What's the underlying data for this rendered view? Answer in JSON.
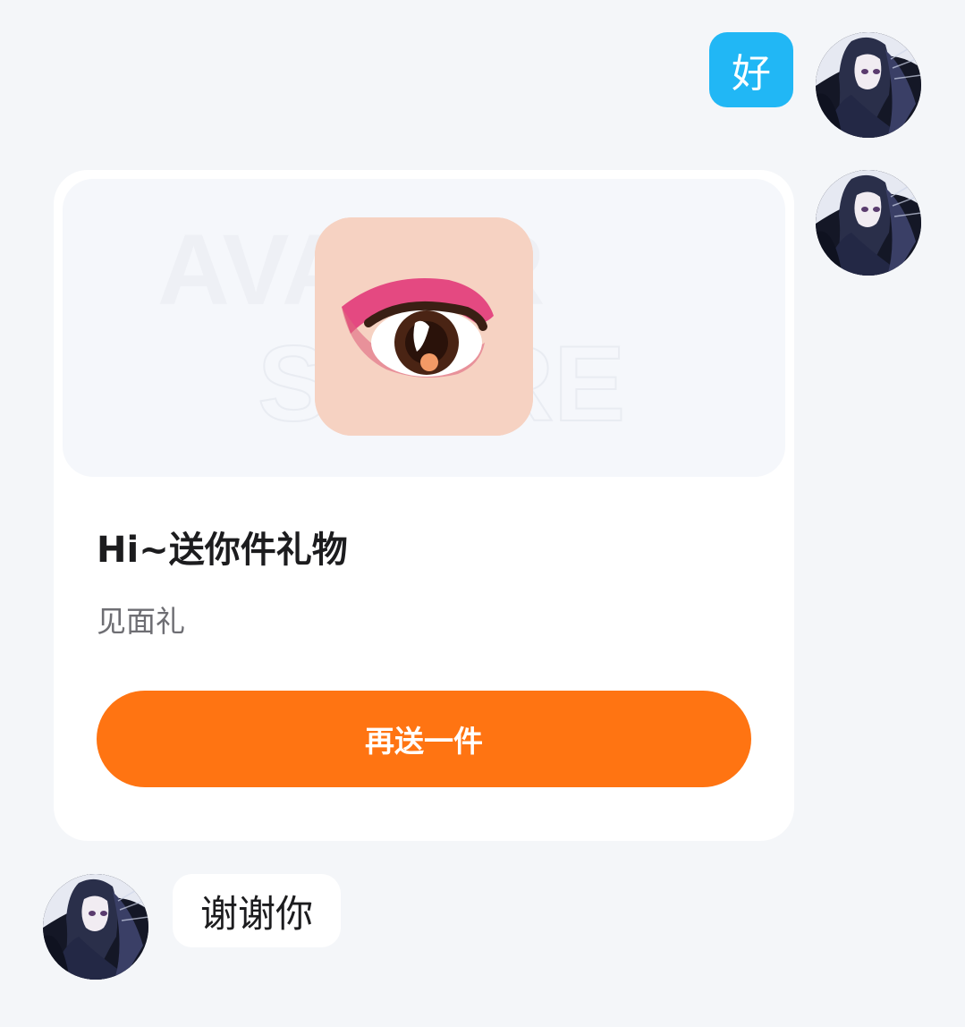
{
  "messages": {
    "sent_text": "好",
    "received_text": "谢谢你"
  },
  "gift_card": {
    "watermark_line1": "AVATAR",
    "watermark_line2": "STORE",
    "title": "Hi~送你件礼物",
    "subtitle": "见面礼",
    "button_label": "再送一件"
  },
  "colors": {
    "sent_bubble": "#21b7f5",
    "button": "#ff7412",
    "background": "#f4f6f9"
  }
}
